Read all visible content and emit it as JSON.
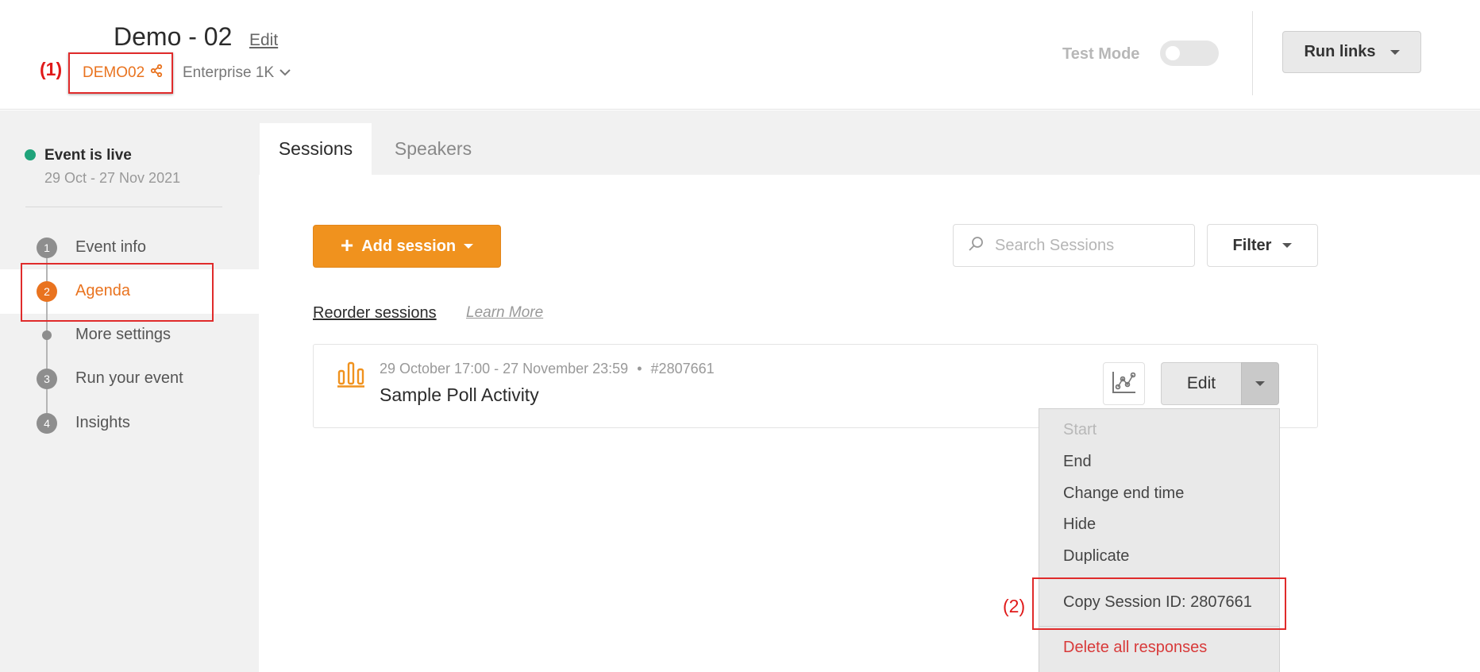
{
  "header": {
    "event_title": "Demo - 02",
    "edit_label": "Edit",
    "event_code": "DEMO02",
    "plan": "Enterprise 1K",
    "test_mode_label": "Test Mode",
    "test_mode_on": false,
    "run_links_label": "Run links"
  },
  "annotations": {
    "one": "(1)",
    "two": "(2)",
    "highlight_color": "#e02b2b"
  },
  "sidebar": {
    "status": "Event is live",
    "status_color": "#1fa37a",
    "dates": "29 Oct - 27 Nov 2021",
    "steps": [
      {
        "num": "1",
        "label": "Event info"
      },
      {
        "num": "2",
        "label": "Agenda",
        "active": true
      },
      {
        "num": "",
        "label": "More settings"
      },
      {
        "num": "3",
        "label": "Run your event"
      },
      {
        "num": "4",
        "label": "Insights"
      }
    ]
  },
  "tabs": [
    {
      "label": "Sessions",
      "active": true
    },
    {
      "label": "Speakers",
      "active": false
    }
  ],
  "toolbar": {
    "add_session_label": "Add session",
    "search_placeholder": "Search Sessions",
    "filter_label": "Filter",
    "accent_color": "#f0921e"
  },
  "links": {
    "reorder": "Reorder sessions",
    "learn_more": "Learn More"
  },
  "session": {
    "meta": "29 October 17:00 - 27 November 23:59",
    "separator": "•",
    "id_label": "#2807661",
    "title": "Sample Poll Activity",
    "icon": "poll-bars-icon",
    "edit_label": "Edit"
  },
  "session_menu": {
    "items": [
      {
        "label": "Start",
        "disabled": true
      },
      {
        "label": "End"
      },
      {
        "label": "Change end time"
      },
      {
        "label": "Hide"
      },
      {
        "label": "Duplicate"
      },
      {
        "label": "Copy Session ID: 2807661"
      },
      {
        "label": "Delete all responses",
        "danger": true
      }
    ]
  }
}
